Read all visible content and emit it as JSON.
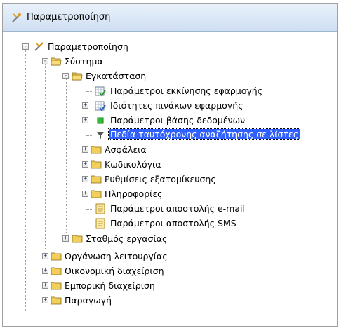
{
  "window": {
    "title": "Παραμετροποίηση"
  },
  "tree": {
    "root": "Παραμετροποίηση",
    "system": "Σύστημα",
    "installation": "Εγκατάσταση",
    "items": [
      "Παράμετροι εκκίνησης εφαρμογής",
      "Ιδιότητες πινάκων εφαρμογής",
      "Παράμετροι βάσης δεδομένων",
      "Πεδία ταυτόχρονης αναζήτησης σε λίστες"
    ],
    "folders": [
      "Ασφάλεια",
      "Κωδικολόγια",
      "Ρυθμίσεις εξατομίκευσης",
      "Πληροφορίες"
    ],
    "mail_items": [
      "Παράμετροι αποστολής e-mail",
      "Παράμετροι αποστολής SMS"
    ],
    "workstation": "Σταθμός εργασίας",
    "top_folders": [
      "Οργάνωση λειτουργίας",
      "Οικονομική διαχείριση",
      "Εμπορική διαχείριση",
      "Παραγωγή"
    ]
  },
  "colors": {
    "selection": "#3060ff",
    "folder": "#f2cf5b"
  }
}
